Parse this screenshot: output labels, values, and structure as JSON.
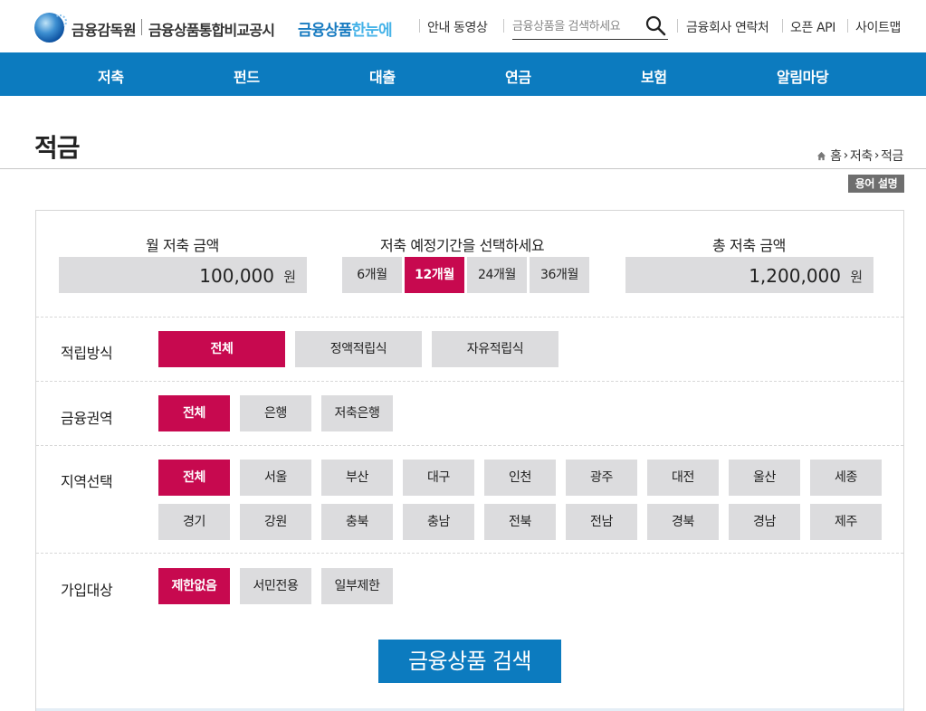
{
  "header": {
    "org_name": "금융감독원",
    "site_title": "금융상품통합비교공시",
    "site_sub_main": "금융상품",
    "site_sub_aux": "한눈에",
    "links": [
      "안내 동영상",
      "금융회사 연락처",
      "오픈 API",
      "사이트맵"
    ],
    "search_placeholder": "금융상품을 검색하세요"
  },
  "main_nav": [
    "저축",
    "펀드",
    "대출",
    "연금",
    "보험",
    "알림마당"
  ],
  "page": {
    "title": "적금",
    "breadcrumb": [
      "홈",
      "저축",
      "적금"
    ],
    "term_button": "용어 설명"
  },
  "calculator": {
    "monthly_label": "월 저축 금액",
    "monthly_amount": "100,000",
    "period_label": "저축 예정기간을 선택하세요",
    "periods": [
      "6개월",
      "12개월",
      "24개월",
      "36개월"
    ],
    "selected_period": "12개월",
    "total_label": "총 저축 금액",
    "total_amount": "1,200,000",
    "unit": "원"
  },
  "filters": {
    "method": {
      "label": "적립방식",
      "options": [
        "전체",
        "정액적립식",
        "자유적립식"
      ],
      "selected": "전체"
    },
    "sector": {
      "label": "금융권역",
      "options": [
        "전체",
        "은행",
        "저축은행"
      ],
      "selected": "전체"
    },
    "region": {
      "label": "지역선택",
      "row1": [
        "전체",
        "서울",
        "부산",
        "대구",
        "인천",
        "광주",
        "대전",
        "울산",
        "세종"
      ],
      "row2": [
        "경기",
        "강원",
        "충북",
        "충남",
        "전북",
        "전남",
        "경북",
        "경남",
        "제주"
      ],
      "selected": "전체"
    },
    "target": {
      "label": "가입대상",
      "options": [
        "제한없음",
        "서민전용",
        "일부제한"
      ],
      "selected": "제한없음"
    }
  },
  "search_button": "금융상품 검색",
  "colors": {
    "primary_blue": "#0c7bbf",
    "selected_magenta": "#c7094f",
    "option_gray": "#dcdcde"
  }
}
